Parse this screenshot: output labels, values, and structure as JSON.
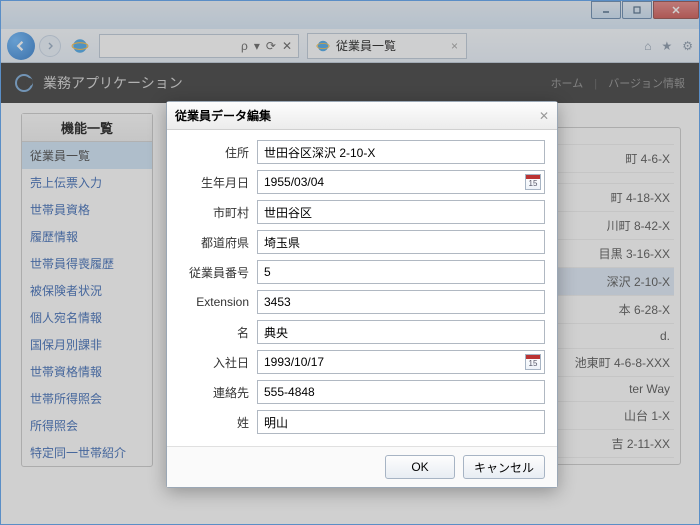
{
  "window": {
    "tab_title": "従業員一覧",
    "search_trail": "ρ ▾   ⟳ ⊘ ×"
  },
  "app": {
    "title": "業務アプリケーション",
    "menu_home": "ホーム",
    "menu_version": "バージョン情報"
  },
  "sidebar": {
    "title": "機能一覧",
    "items": [
      "従業員一覧",
      "売上伝票入力",
      "世帯員資格",
      "履歴情報",
      "世帯員得喪履歴",
      "被保険者状況",
      "個人宛名情報",
      "国保月別課非",
      "世帯資格情報",
      "世帯所得照会",
      "所得照会",
      "特定同一世帯紹介"
    ]
  },
  "bg_rows": [
    "",
    "町 4-6-X",
    "",
    "町 4-18-XX",
    "川町 8-42-X",
    "目黒 3-16-XX",
    "深沢 2-10-X",
    "本 6-28-X",
    "d.",
    "池東町 4-6-8-XXX",
    "ter Way",
    "山台 1-X",
    "吉 2-11-XX"
  ],
  "dialog": {
    "title": "従業員データ編集",
    "ok": "OK",
    "cancel": "キャンセル",
    "labels": {
      "address": "住所",
      "birthdate": "生年月日",
      "city": "市町村",
      "pref": "都道府県",
      "emp_no": "従業員番号",
      "ext": "Extension",
      "first": "名",
      "hire": "入社日",
      "phone": "連絡先",
      "last": "姓"
    },
    "values": {
      "address": "世田谷区深沢 2-10-X",
      "birthdate": "1955/03/04",
      "city": "世田谷区",
      "pref": "埼玉県",
      "emp_no": "5",
      "ext": "3453",
      "first": "典央",
      "hire": "1993/10/17",
      "phone": "555-4848",
      "last": "明山"
    },
    "cal_day": "15"
  }
}
